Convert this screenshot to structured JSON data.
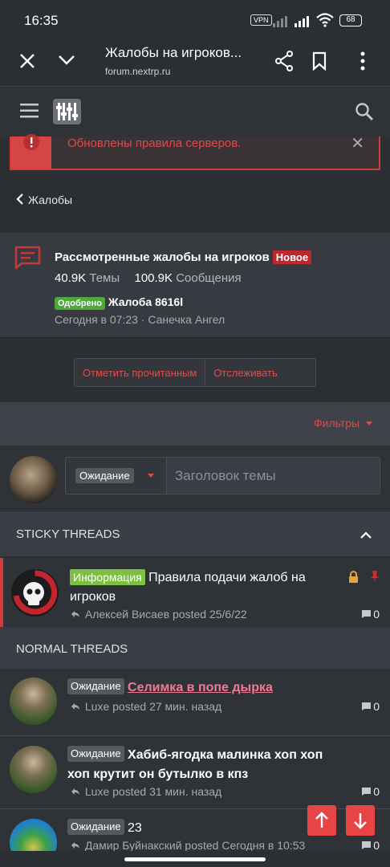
{
  "status_bar": {
    "time": "16:35",
    "vpn": "VPN",
    "battery": "68"
  },
  "browser": {
    "title": "Жалобы на игроков...",
    "url": "forum.nextrp.ru"
  },
  "notice": {
    "text": "Обновлены правила серверов."
  },
  "breadcrumb": {
    "label": "Жалобы"
  },
  "forum": {
    "title": "Рассмотренные жалобы на игроков",
    "badge": "Новое",
    "threads_count": "40.9K",
    "threads_label": "Темы",
    "messages_count": "100.9K",
    "messages_label": "Сообщения",
    "last_thread": {
      "prefix": "Одобрено",
      "title": "Жалоба 8616l",
      "meta": "Сегодня в 07:23 · Санечка Ангел"
    }
  },
  "actions": {
    "mark_read": "Отметить прочитанным",
    "watch": "Отслеживать"
  },
  "filters": {
    "label": "Фильтры"
  },
  "new_thread": {
    "prefix": "Ожидание",
    "placeholder": "Заголовок темы"
  },
  "sections": {
    "sticky": "STICKY THREADS",
    "normal": "NORMAL THREADS"
  },
  "sticky_threads": [
    {
      "prefix": "Информация",
      "title": "Правила подачи жалоб на игроков",
      "meta": "Алексей Висаев posted 25/6/22",
      "replies": "0"
    }
  ],
  "normal_threads": [
    {
      "prefix": "Ожидание",
      "title": "Селимка в попе дырка",
      "meta": "Luxe posted 27 мин. назад",
      "replies": "0"
    },
    {
      "prefix": "Ожидание",
      "title": "Хабиб-ягодка малинка хоп хоп хоп крутит он бутылко в кпз",
      "meta": "Luxe posted 31 мин. назад",
      "replies": "0"
    },
    {
      "prefix": "Ожидание",
      "title": "23",
      "meta": "Дамир Буйнакский posted Сегодня в 10:53",
      "replies": "0"
    }
  ],
  "colors": {
    "accent": "#e04848",
    "approved": "#4caa3c",
    "info": "#7cc043",
    "new_badge": "#c0262d"
  }
}
